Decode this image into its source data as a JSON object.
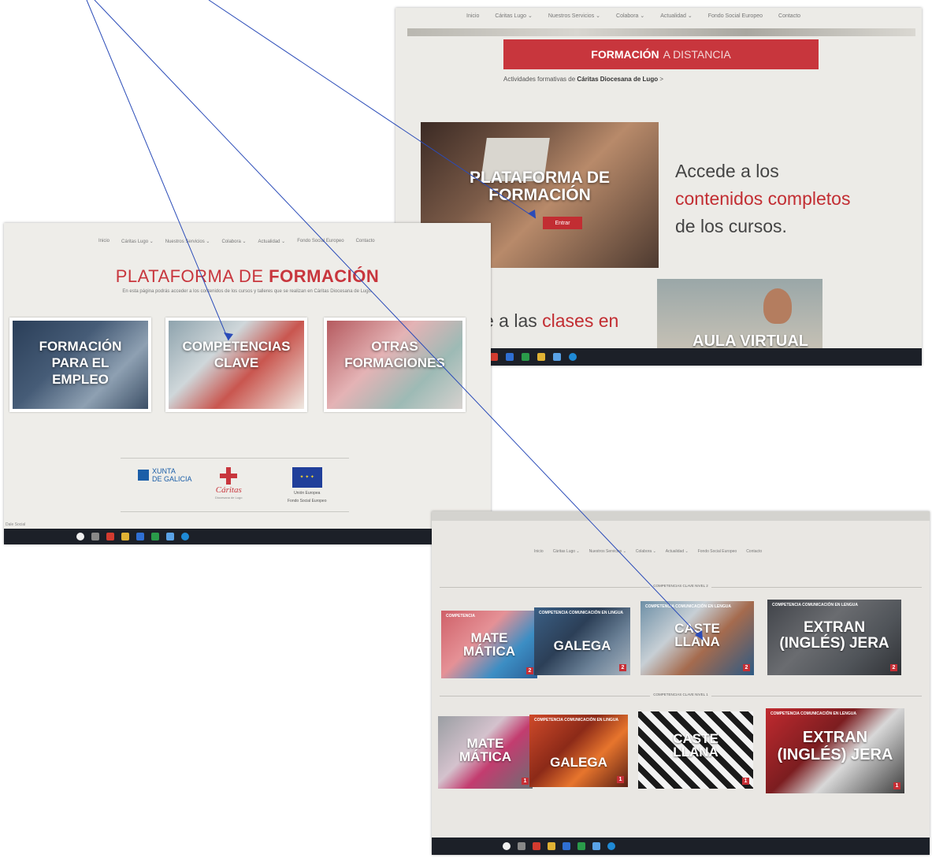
{
  "shotA": {
    "nav": [
      "Inicio",
      "Cáritas Lugo ⌄",
      "Nuestros Servicios ⌄",
      "Colabora ⌄",
      "Actualidad ⌄",
      "Fondo Social Europeo",
      "Contacto"
    ],
    "banner_bold": "FORMACIÓN",
    "banner_rest": "A DISTANCIA",
    "crumb_prefix": "Actividades formativas de",
    "crumb_bold": "Cáritas Diocesana de Lugo",
    "crumb_suffix": ">",
    "card_title_line1": "PLATAFORMA DE",
    "card_title_line2": "FORMACIÓN",
    "enter_button": "Entrar",
    "access_line1": "Accede a los",
    "access_line2": "contenidos completos",
    "access_line3": "de los cursos.",
    "clases_prefix": "e a las",
    "clases_red": "clases en",
    "aula_title": "AULA VIRTUAL"
  },
  "shotB": {
    "nav": [
      "Inicio",
      "Cáritas Lugo ⌄",
      "Nuestros Servicios ⌄",
      "Colabora ⌄",
      "Actualidad ⌄",
      "Fondo Social Europeo",
      "Contacto"
    ],
    "title_prefix": "PLATAFORMA DE",
    "title_bold": "FORMACIÓN",
    "subtitle": "En esta página podrás acceder a los contenidos de los cursos y talleres que se realizan en Cáritas Diocesana de Lugo.",
    "tiles": [
      {
        "line1": "FORMACIÓN",
        "line2": "PARA EL",
        "line3": "EMPLEO"
      },
      {
        "line1": "COMPETENCIAS",
        "line2": "CLAVE",
        "line3": ""
      },
      {
        "line1": "OTRAS",
        "line2": "FORMACIONES",
        "line3": ""
      }
    ],
    "xunta_line1": "XUNTA",
    "xunta_line2": "DE GALICIA",
    "caritas": "Cáritas",
    "caritas_sub": "Diocesana de Lugo",
    "eu_line1": "Unión Europea",
    "eu_line2": "Fondo Social Europeo",
    "status": "Dale Social"
  },
  "shotC": {
    "nav": [
      "Inicio",
      "Cáritas Lugo ⌄",
      "Nuestros Servicios ⌄",
      "Colabora ⌄",
      "Actualidad ⌄",
      "Fondo Social Europeo",
      "Contacto"
    ],
    "section1": "COMPETENCIAS CLAVE NIVEL 2",
    "section2": "COMPETENCIAS CLAVE NIVEL 1",
    "row1": [
      {
        "tag": "COMPETENCIA",
        "t1": "MATE",
        "t2": "MÁTICA",
        "num": "2"
      },
      {
        "tag": "COMPETENCIA COMUNICACIÓN EN LINGUA",
        "t1": "GALEGA",
        "t2": "",
        "num": "2"
      },
      {
        "tag": "COMPETENCIA COMUNICACIÓN EN LENGUA",
        "t1": "CASTE",
        "t2": "LLANA",
        "num": "2"
      },
      {
        "tag": "COMPETENCIA COMUNICACIÓN EN LENGUA",
        "t1": "EXTRAN",
        "t2": "(INGLÉS) JERA",
        "num": "2"
      }
    ],
    "row2": [
      {
        "tag": "",
        "t1": "MATE",
        "t2": "MÁTICA",
        "num": "1"
      },
      {
        "tag": "COMPETENCIA COMUNICACIÓN EN LINGUA",
        "t1": "GALEGA",
        "t2": "",
        "num": "1"
      },
      {
        "tag": "",
        "t1": "CASTE",
        "t2": "LLANA",
        "num": "1"
      },
      {
        "tag": "COMPETENCIA COMUNICACIÓN EN LENGUA",
        "t1": "EXTRAN",
        "t2": "(INGLÉS) JERA",
        "num": "1"
      }
    ]
  }
}
